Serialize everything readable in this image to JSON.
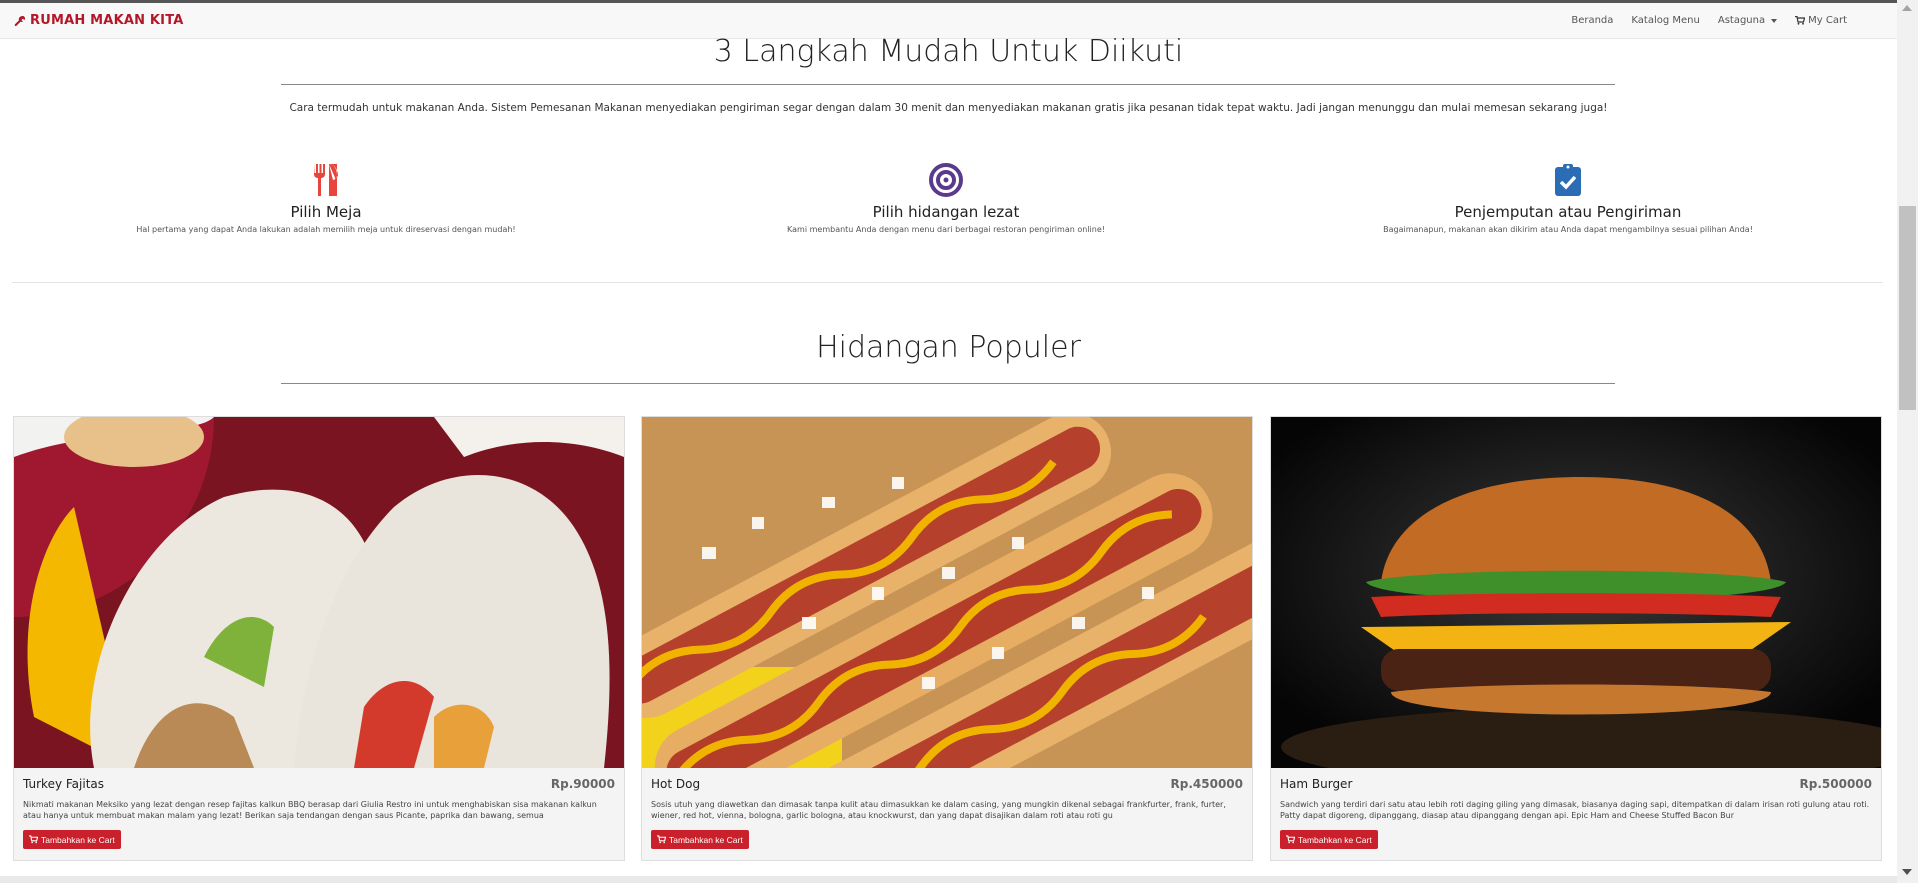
{
  "brand": {
    "name": "RUMAH MAKAN KITA",
    "icon": "wrench-icon",
    "color": "#b5172a"
  },
  "nav": {
    "home": "Beranda",
    "catalog": "Katalog Menu",
    "user": "Astaguna",
    "cart": "My Cart"
  },
  "steps": {
    "title": "3 Langkah Mudah Untuk Diikuti",
    "description": "Cara termudah untuk makanan Anda. Sistem Pemesanan Makanan menyediakan pengiriman segar dengan dalam 30 menit dan menyediakan makanan gratis jika pesanan tidak tepat waktu. Jadi jangan menunggu dan mulai memesan sekarang juga!",
    "items": [
      {
        "title": "Pilih Meja",
        "desc": "Hal pertama yang dapat Anda lakukan adalah memilih meja untuk direservasi dengan mudah!",
        "icon": "utensils-icon",
        "color": "#e8463d"
      },
      {
        "title": "Pilih hidangan lezat",
        "desc": "Kami membantu Anda dengan menu dari berbagai restoran pengiriman online!",
        "icon": "target-icon",
        "color": "#5b3a8c"
      },
      {
        "title": "Penjemputan atau Pengiriman",
        "desc": "Bagaimanapun, makanan akan dikirim atau Anda dapat mengambilnya sesuai pilihan Anda!",
        "icon": "clipboard-check-icon",
        "color": "#2a6db5"
      }
    ]
  },
  "popular": {
    "title": "Hidangan Populer",
    "button_label": "Tambahkan ke Cart",
    "button_color": "#c9202b",
    "items": [
      {
        "name": "Turkey Fajitas",
        "price": "Rp.90000",
        "desc": "Nikmati makanan Meksiko yang lezat dengan resep fajitas kalkun BBQ berasap dari Giulia Restro ini untuk menghabiskan sisa makanan kalkun atau hanya untuk membuat makan malam yang lezat! Berikan saja tendangan dengan saus Picante, paprika dan bawang, semua"
      },
      {
        "name": "Hot Dog",
        "price": "Rp.450000",
        "desc": "Sosis utuh yang diawetkan dan dimasak tanpa kulit atau dimasukkan ke dalam casing, yang mungkin dikenal sebagai frankfurter, frank, furter, wiener, red hot, vienna, bologna, garlic bologna, atau knockwurst, dan yang dapat disajikan dalam roti atau roti gu"
      },
      {
        "name": "Ham Burger",
        "price": "Rp.500000",
        "desc": "Sandwich yang terdiri dari satu atau lebih roti daging giling yang dimasak, biasanya daging sapi, ditempatkan di dalam irisan roti gulung atau roti. Patty dapat digoreng, dipanggang, diasap atau dipanggang dengan api. Epic Ham and Cheese Stuffed Bacon Bur"
      }
    ]
  }
}
